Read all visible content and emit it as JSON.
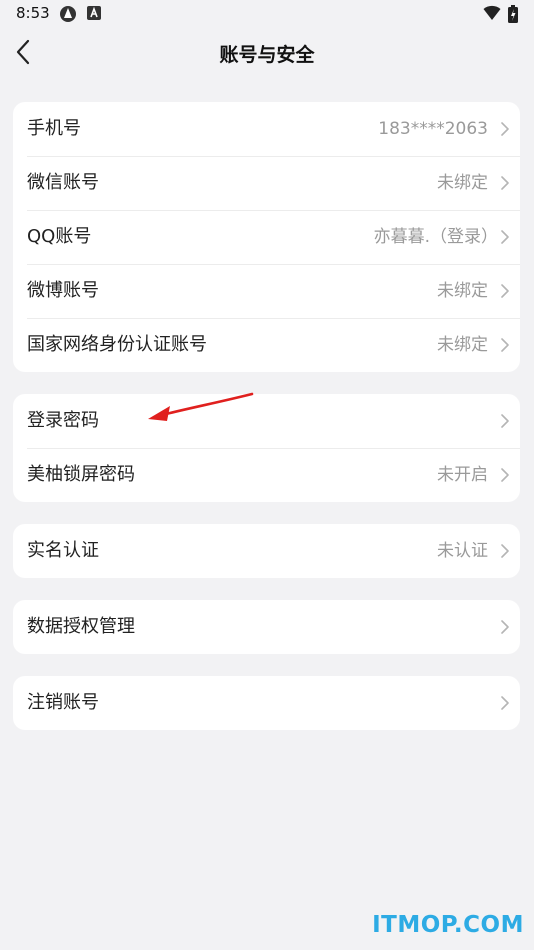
{
  "status_bar": {
    "time": "8:53"
  },
  "header": {
    "title": "账号与安全"
  },
  "groups": [
    {
      "rows": [
        {
          "label": "手机号",
          "value": "183****2063"
        },
        {
          "label": "微信账号",
          "value": "未绑定"
        },
        {
          "label": "QQ账号",
          "value": "亦暮暮.（登录）"
        },
        {
          "label": "微博账号",
          "value": "未绑定"
        },
        {
          "label": "国家网络身份认证账号",
          "value": "未绑定"
        }
      ]
    },
    {
      "rows": [
        {
          "label": "登录密码",
          "value": ""
        },
        {
          "label": "美柚锁屏密码",
          "value": "未开启"
        }
      ]
    },
    {
      "rows": [
        {
          "label": "实名认证",
          "value": "未认证"
        }
      ]
    },
    {
      "rows": [
        {
          "label": "数据授权管理",
          "value": ""
        }
      ]
    },
    {
      "rows": [
        {
          "label": "注销账号",
          "value": ""
        }
      ]
    }
  ],
  "watermark": "ITMOP.COM",
  "colors": {
    "background": "#f2f2f4",
    "card": "#ffffff",
    "value_text": "#9a9a9a",
    "watermark": "#2dabe4",
    "annotation_arrow": "#e0201e"
  },
  "icons": {
    "back": "chevron-left-icon",
    "row": "chevron-right-icon",
    "status": [
      "vpn-icon",
      "accessibility-icon",
      "wifi-icon",
      "battery-icon"
    ]
  }
}
